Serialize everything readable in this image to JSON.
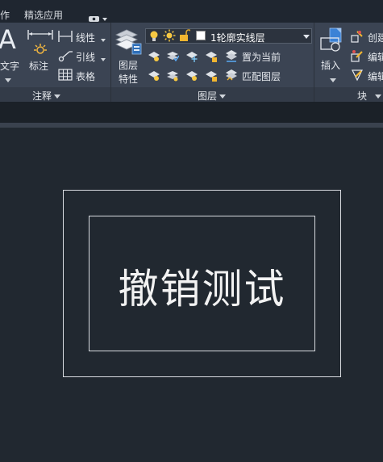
{
  "menubar": {
    "items": [
      "作",
      "精选应用"
    ],
    "camera_icon": "camera-icon"
  },
  "ribbon": {
    "annotation": {
      "text_label": "文字",
      "dim_label": "标注",
      "linear_label": "线性",
      "leader_label": "引线",
      "table_label": "表格",
      "panel_title": "注释"
    },
    "layers": {
      "layer_props_label_1": "图层",
      "layer_props_label_2": "特性",
      "current_layer": "1轮廓实线层",
      "current_layer_color": "#ffffff",
      "set_current_label": "置为当前",
      "match_layer_label": "匹配图层",
      "panel_title": "图层"
    },
    "block": {
      "insert_label": "插入",
      "create_label": "创建",
      "edit_label_1": "编辑",
      "edit_label_2": "编辑",
      "panel_title": "块"
    }
  },
  "canvas": {
    "text": "撤销测试",
    "background": "#212830",
    "line_color": "#d8dbe0"
  }
}
